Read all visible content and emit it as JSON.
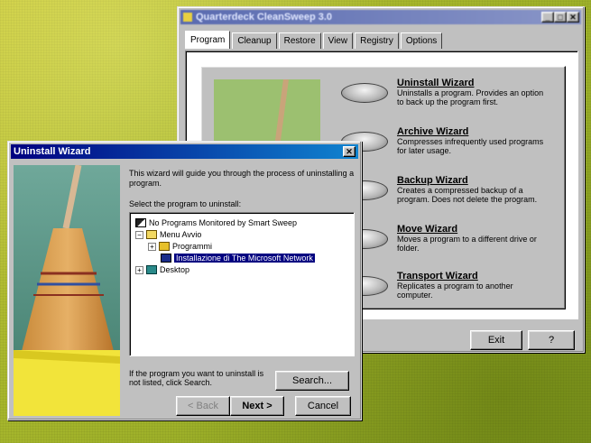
{
  "cleansweep": {
    "title": "Quarterdeck CleanSweep 3.0",
    "tabs": [
      "Program",
      "Cleanup",
      "Restore",
      "View",
      "Registry",
      "Options"
    ],
    "active_tab": 0,
    "wizards": [
      {
        "title": "Uninstall Wizard",
        "desc": "Uninstalls a program. Provides an option to back up the program first."
      },
      {
        "title": "Archive Wizard",
        "desc": "Compresses infrequently used programs for later usage."
      },
      {
        "title": "Backup Wizard",
        "desc": "Creates a compressed backup of a program. Does not delete the program."
      },
      {
        "title": "Move Wizard",
        "desc": "Moves a program to a different drive or folder."
      },
      {
        "title": "Transport Wizard",
        "desc": "Replicates a program to another computer."
      }
    ],
    "exit_label": "Exit",
    "help_label": "?"
  },
  "uninstall": {
    "title": "Uninstall Wizard",
    "close_glyph": "✕",
    "intro": "This wizard will guide you through the process of uninstalling a program.",
    "select_label": "Select the program to uninstall:",
    "tree": {
      "item0": "No Programs Monitored by Smart Sweep",
      "item1": "Menu Avvio",
      "item2": "Programmi",
      "item3": "Installazione di The Microsoft Network",
      "item4": "Desktop"
    },
    "hint": "If the program you want to uninstall is not listed, click Search.",
    "search_label": "Search...",
    "back_label": "< Back",
    "next_label": "Next >",
    "cancel_label": "Cancel"
  },
  "colors": {
    "titlebar": "#5a6bb0",
    "selection": "#000080",
    "background_green": "#9fb12a",
    "broom_yellow": "#f2e43a"
  }
}
